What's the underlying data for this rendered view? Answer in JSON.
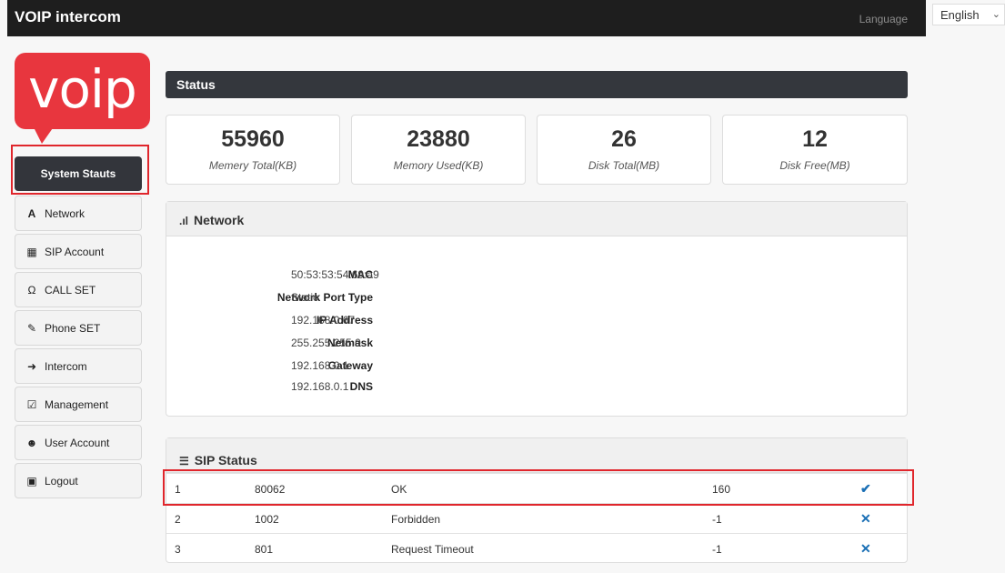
{
  "app": {
    "title": "VOIP intercom",
    "language_label": "Language",
    "language_value": "English"
  },
  "logo": {
    "text": "voip"
  },
  "sidebar": {
    "active": "System Stauts",
    "items": [
      {
        "label": "Network",
        "icon": "road-icon"
      },
      {
        "label": "SIP Account",
        "icon": "book-icon"
      },
      {
        "label": "CALL SET",
        "icon": "headphones-icon"
      },
      {
        "label": "Phone SET",
        "icon": "pencil-icon"
      },
      {
        "label": "Intercom",
        "icon": "login-icon"
      },
      {
        "label": "Management",
        "icon": "edit-icon"
      },
      {
        "label": "User Account",
        "icon": "user-icon"
      },
      {
        "label": "Logout",
        "icon": "lock-icon"
      }
    ]
  },
  "status": {
    "title": "Status",
    "stats": [
      {
        "value": "55960",
        "label": "Memery Total(KB)"
      },
      {
        "value": "23880",
        "label": "Memory Used(KB)"
      },
      {
        "value": "26",
        "label": "Disk Total(MB)"
      },
      {
        "value": "12",
        "label": "Disk Free(MB)"
      }
    ]
  },
  "network": {
    "title": "Network",
    "rows": [
      {
        "key": "MAC",
        "value": "50:53:53:54:69:a9"
      },
      {
        "key": "Network Port Type",
        "value": "Static"
      },
      {
        "key": "IP Address",
        "value": "192.168.0.67"
      },
      {
        "key": "Netmask",
        "value": "255.255.255.0"
      },
      {
        "key": "Gateway",
        "value": "192.168.0.1"
      },
      {
        "key": "DNS",
        "value": "192.168.0.1"
      }
    ]
  },
  "sip_status": {
    "title": "SIP Status",
    "rows": [
      {
        "index": "1",
        "account": "80062",
        "status": "OK",
        "code": "160",
        "mark": "✔"
      },
      {
        "index": "2",
        "account": "1002",
        "status": "Forbidden",
        "code": "-1",
        "mark": "✕"
      },
      {
        "index": "3",
        "account": "801",
        "status": "Request Timeout",
        "code": "-1",
        "mark": "✕"
      }
    ]
  },
  "colors": {
    "highlight": "#e0262c",
    "logo": "#e8363e",
    "topbar": "#1e1e1e",
    "check": "#1a6fb5"
  }
}
